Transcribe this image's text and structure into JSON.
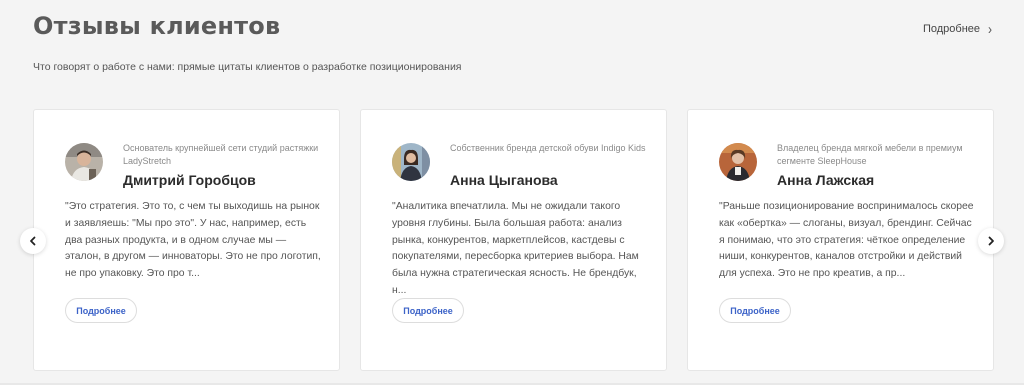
{
  "header": {
    "title": "Отзывы клиентов",
    "more_label": "Подробнее",
    "subtitle": "Что говорят о работе с нами: прямые цитаты клиентов о разработке позиционирования"
  },
  "cards": [
    {
      "role": "Основатель крупнейшей сети студий растяжки LadyStretch",
      "name": "Дмитрий Горобцов",
      "quote": "\"Это стратегия. Это то, с чем ты выходишь на рынок и заявляешь: \"Мы про это\". У нас, например, есть два разных продукта, и в одном случае мы — эталон, в другом — инноваторы. Это не про логотип, не про упаковку. Это про т...",
      "button": "Подробнее"
    },
    {
      "role": "Собственник бренда детской обуви Indigo Kids",
      "name": "Анна Цыганова",
      "quote": "\"Аналитика впечатлила. Мы не ожидали такого уровня глубины. Была большая работа: анализ рынка, конкурентов, маркетплейсов, кастдевы с покупателями, пересборка критериев выбора. Нам была нужна стратегическая ясность. Не брендбук, н...",
      "button": "Подробнее"
    },
    {
      "role": "Владелец бренда мягкой мебели в премиум сегменте SleepHouse",
      "name": "Анна Лажская",
      "quote": "\"Раньше позиционирование воспринималось скорее как «обертка» — слоганы, визуал, брендинг. Сейчас я понимаю, что это стратегия: чёткое определение ниши, конкурентов, каналов отстройки и действий для успеха. Это не про креатив, а пр...",
      "button": "Подробнее"
    }
  ],
  "nav": {
    "prev_icon": "chevron-left-icon",
    "next_icon": "chevron-right-icon"
  },
  "colors": {
    "background": "#f4f4f4",
    "card": "#ffffff",
    "title": "#5a5a5a",
    "link_blue": "#3c63c8"
  }
}
